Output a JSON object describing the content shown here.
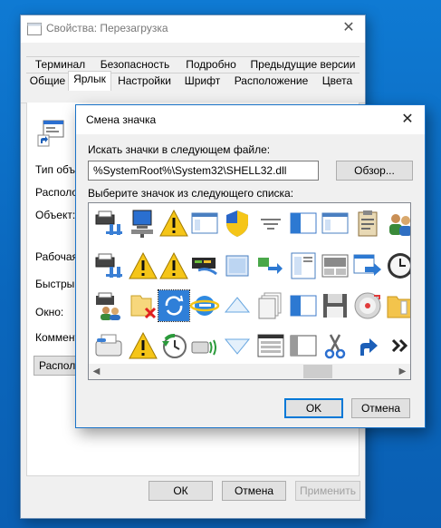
{
  "props_window": {
    "title": "Свойства: Перезагрузка",
    "tabs_row1": [
      "Терминал",
      "Безопасность",
      "Подробно",
      "Предыдущие версии"
    ],
    "tabs_row2": [
      "Общие",
      "Ярлык",
      "Настройки",
      "Шрифт",
      "Расположение",
      "Цвета"
    ],
    "selected_tab": "Ярлык",
    "labels": {
      "type": "Тип объе",
      "location": "Располо",
      "target": "Объект:",
      "workdir": "Рабочая п",
      "shortcut": "Быстрый",
      "window": "Окно:",
      "comment": "Коммента"
    },
    "location_button": "Располо",
    "buttons": {
      "ok": "ОК",
      "cancel": "Отмена",
      "apply": "Применить"
    }
  },
  "change_icon_dialog": {
    "title": "Смена значка",
    "file_label": "Искать значки в следующем файле:",
    "file_path": "%SystemRoot%\\System32\\SHELL32.dll",
    "browse_button": "Обзор...",
    "list_label": "Выберите значок из следующего списка:",
    "icon_names": [
      [
        "printer-network-icon",
        "network-computer-icon",
        "warning-icon",
        "window-icon",
        "shield-icon",
        "filter-icon",
        "panel-left-icon",
        "window-icon",
        "clipboard-icon",
        "users-icon"
      ],
      [
        "printer-network-icon",
        "warning-icon",
        "warning-icon",
        "network-drive-icon",
        "window-blank-icon",
        "move-to-folder-icon",
        "document-window-icon",
        "window-panes-icon",
        "window-arrow-icon",
        "clock-icon"
      ],
      [
        "printer-users-icon",
        "folder-delete-icon",
        "sync-icon",
        "internet-explorer-icon",
        "triangle-up-icon",
        "stacked-pages-icon",
        "panel-left-icon",
        "floppy-disk-icon",
        "cd-drive-icon",
        "folder-icon"
      ],
      [
        "fax-icon",
        "warning-icon",
        "restore-icon",
        "wireless-device-icon",
        "triangle-down-icon",
        "list-window-icon",
        "panel-split-icon",
        "scissors-icon",
        "shortcut-arrow-icon",
        "double-chevron-icon"
      ]
    ],
    "buttons": {
      "ok": "OK",
      "cancel": "Отмена"
    }
  }
}
